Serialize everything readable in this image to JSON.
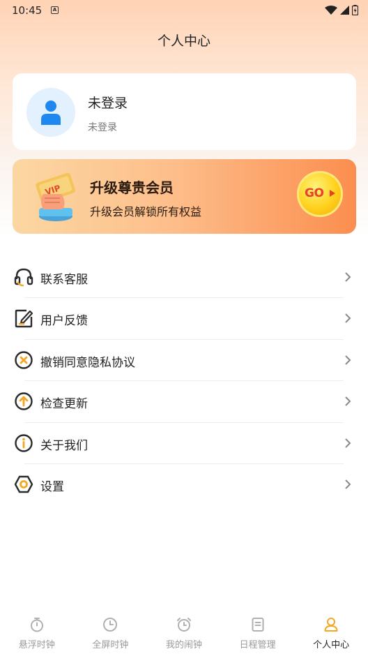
{
  "status_bar": {
    "time": "10:45",
    "notification_glyph": "A"
  },
  "header": {
    "title": "个人中心"
  },
  "profile": {
    "name": "未登录",
    "status": "未登录",
    "avatar_icon": "user-icon"
  },
  "vip": {
    "title": "升级尊贵会员",
    "subtitle": "升级会员解锁所有权益",
    "badge_text": "VIP",
    "go_label": "GO"
  },
  "menu": [
    {
      "label": "联系客服",
      "icon": "headset-icon"
    },
    {
      "label": "用户反馈",
      "icon": "edit-icon"
    },
    {
      "label": "撤销同意隐私协议",
      "icon": "close-circle-icon"
    },
    {
      "label": "检查更新",
      "icon": "arrow-up-circle-icon"
    },
    {
      "label": "关于我们",
      "icon": "info-icon"
    },
    {
      "label": "设置",
      "icon": "gear-hex-icon"
    }
  ],
  "bottom_nav": [
    {
      "label": "悬浮时钟",
      "icon": "stopwatch-icon",
      "active": false
    },
    {
      "label": "全屏时钟",
      "icon": "clock-icon",
      "active": false
    },
    {
      "label": "我的闹钟",
      "icon": "alarm-icon",
      "active": false
    },
    {
      "label": "日程管理",
      "icon": "document-icon",
      "active": false
    },
    {
      "label": "个人中心",
      "icon": "person-icon",
      "active": true
    }
  ],
  "colors": {
    "accent": "#f5a623",
    "icon_dark": "#2b2b2b",
    "avatar_blue": "#1e88f0",
    "inactive": "#b0b0b0"
  }
}
